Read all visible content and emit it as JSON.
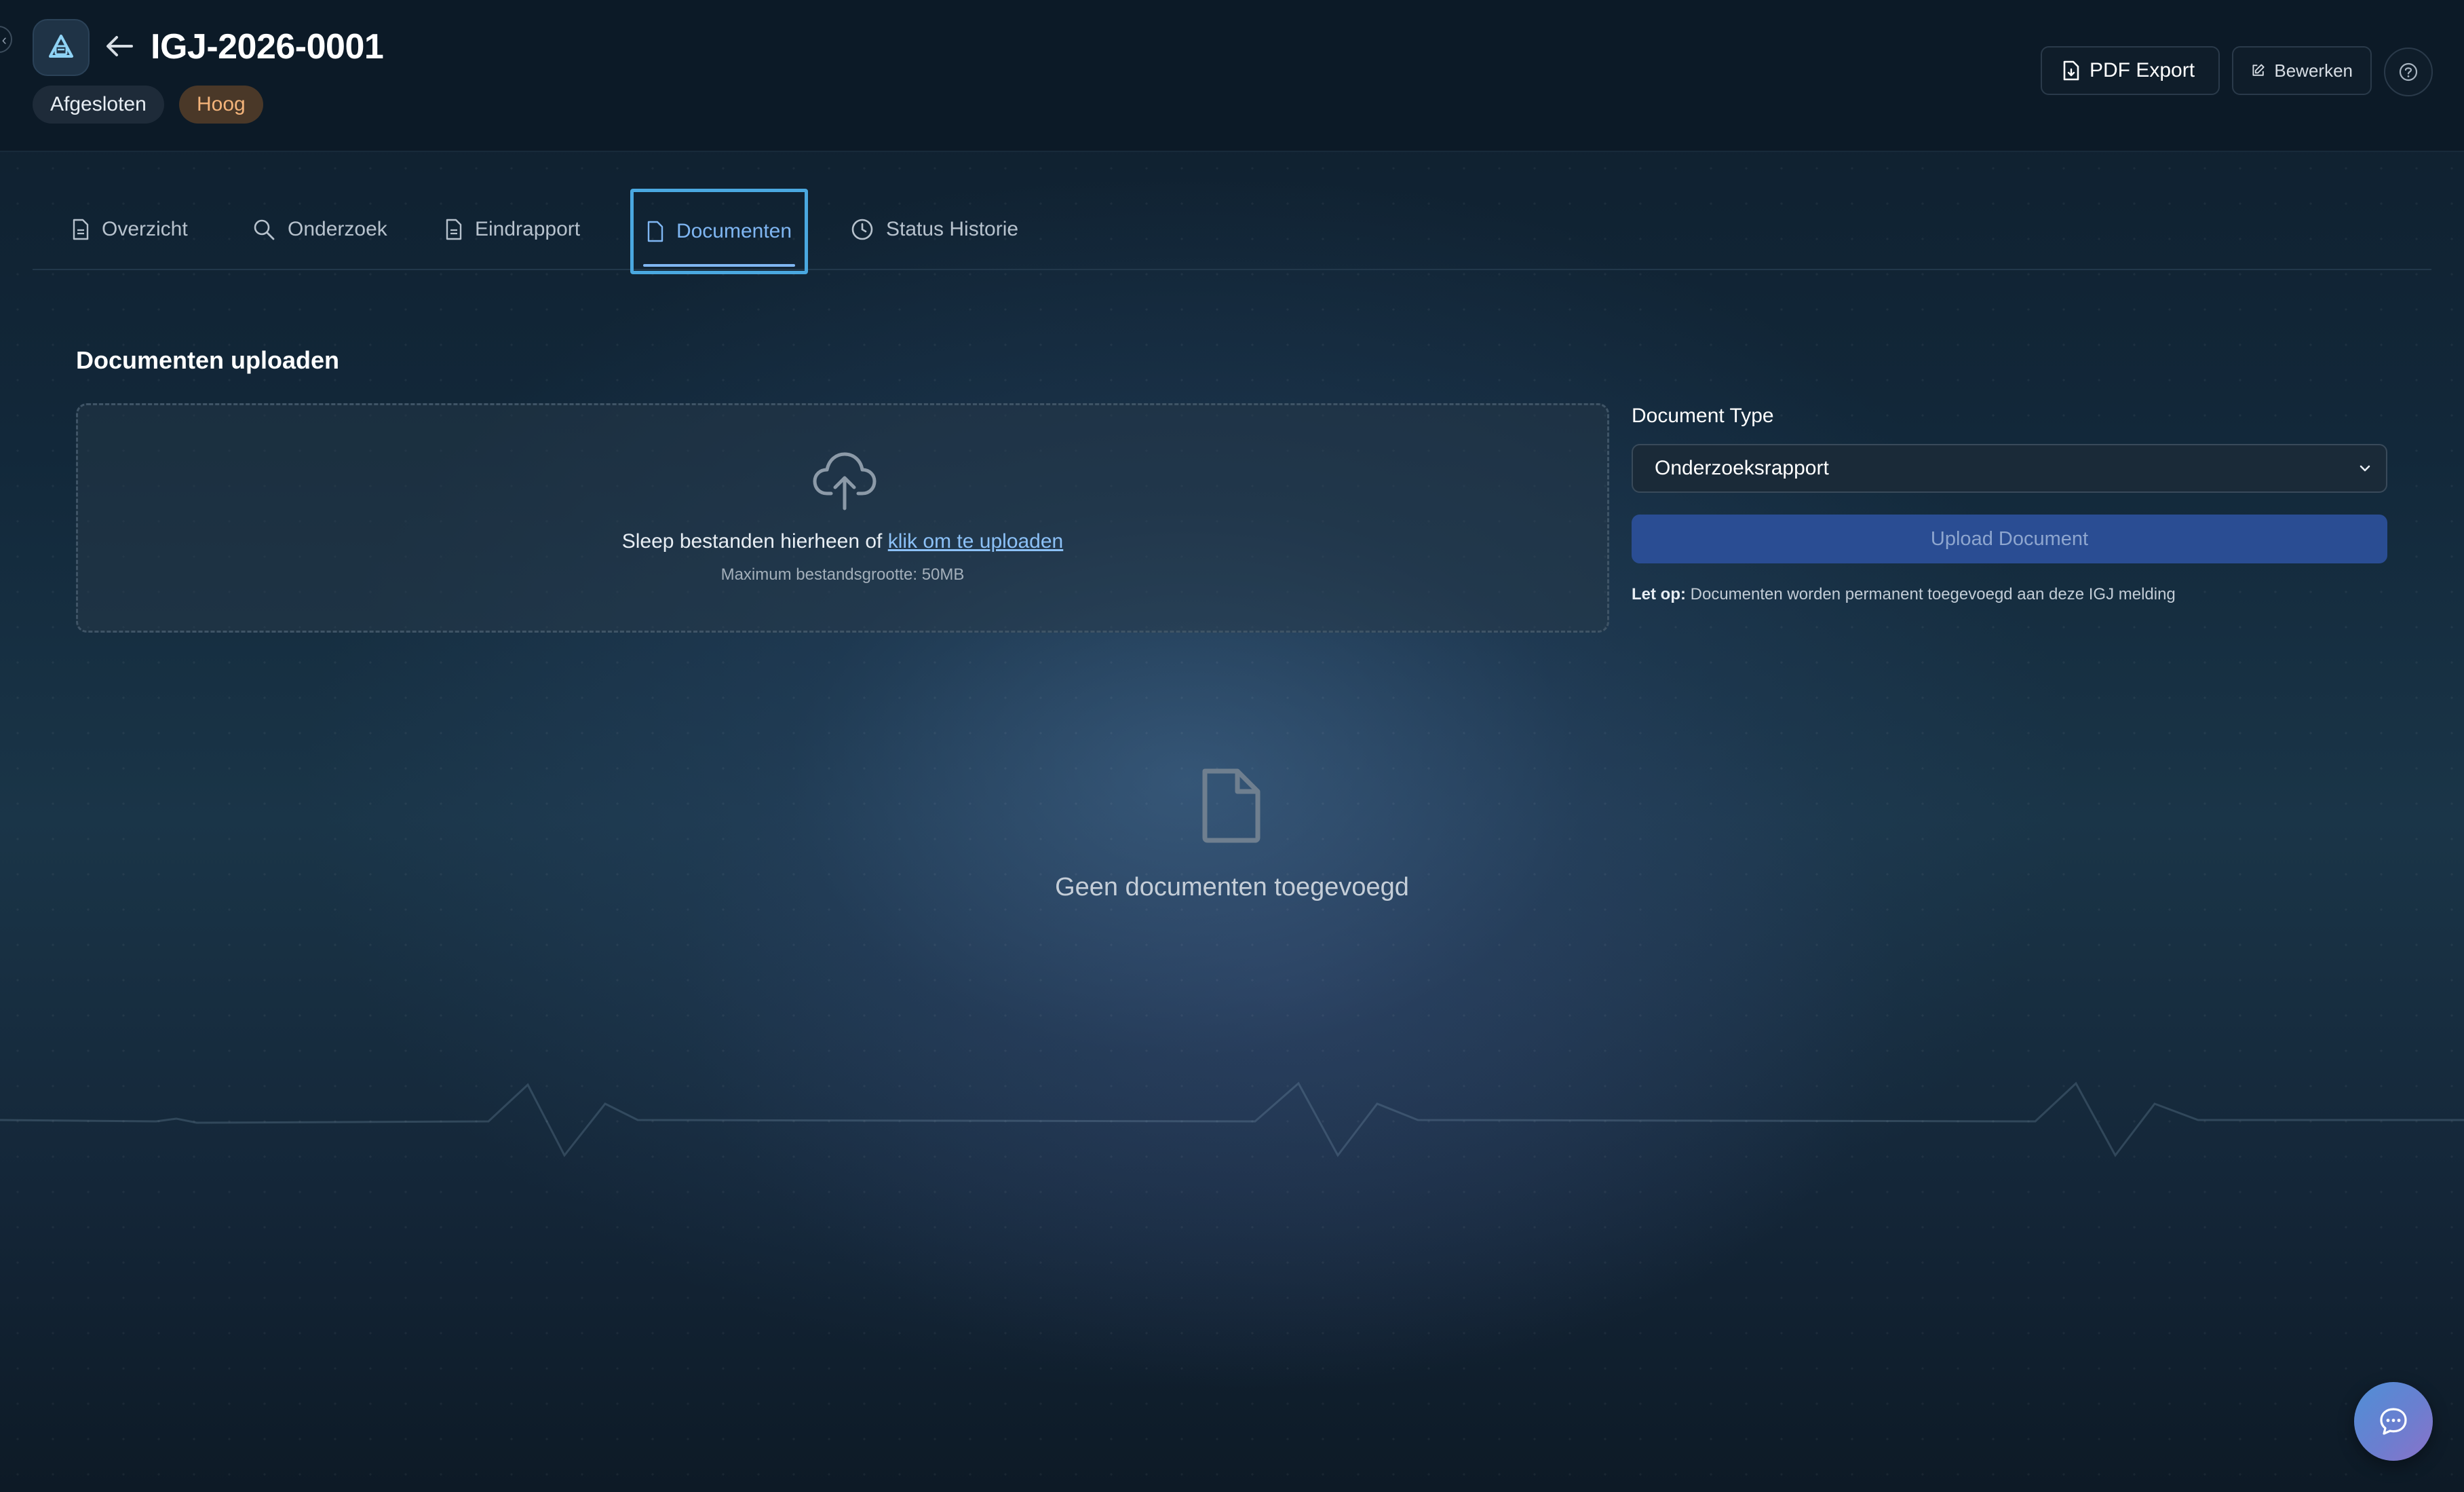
{
  "header": {
    "title": "IGJ-2026-0001",
    "status_badge": "Afgesloten",
    "priority_badge": "Hoog",
    "pdf_export_label": "PDF Export",
    "edit_label": "Bewerken"
  },
  "tabs": [
    {
      "label": "Overzicht",
      "icon": "file-text-icon",
      "active": false
    },
    {
      "label": "Onderzoek",
      "icon": "search-icon",
      "active": false
    },
    {
      "label": "Eindrapport",
      "icon": "file-text-icon",
      "active": false
    },
    {
      "label": "Documenten",
      "icon": "file-icon",
      "active": true
    },
    {
      "label": "Status Historie",
      "icon": "clock-icon",
      "active": false
    }
  ],
  "upload": {
    "section_title": "Documenten uploaden",
    "drop_text": "Sleep bestanden hierheen of",
    "drop_link": "klik om te uploaden",
    "max_size": "Maximum bestandsgrootte: 50MB",
    "document_type_label": "Document Type",
    "document_type_value": "Onderzoeksrapport",
    "upload_button": "Upload Document",
    "note_prefix": "Let op:",
    "note_text": "Documenten worden permanent toegevoegd aan deze IGJ melding"
  },
  "empty_state": {
    "text": "Geen documenten toegevoegd"
  },
  "colors": {
    "accent": "#4aa8e0",
    "active_tab": "#7fb6f2",
    "priority_text": "#f3b37a",
    "upload_button_bg": "#2a4d93"
  }
}
